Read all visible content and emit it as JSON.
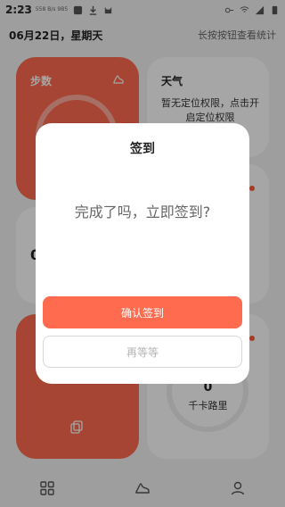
{
  "status_bar": {
    "time": "2:23",
    "speed_text": "558 B/s 9B5",
    "icons_left": [
      "image-icon",
      "download-icon",
      "cat-icon"
    ],
    "icons_right": [
      "key-icon",
      "wifi-icon",
      "signal-icon",
      "battery-icon"
    ]
  },
  "header": {
    "date": "06月22日，星期天",
    "hint": "长按按钮查看统计"
  },
  "cards": {
    "steps": {
      "title": "步数",
      "icon": "shoe-icon"
    },
    "weather": {
      "title": "天气",
      "text": "暂无定位权限，点击开启定位权限"
    },
    "left2": {
      "value": "0"
    },
    "left3": {
      "stub": "****"
    },
    "calories": {
      "value": "0",
      "label": "千卡路里"
    }
  },
  "bottom_nav": [
    {
      "icon": "grid-icon"
    },
    {
      "icon": "shoe-icon"
    },
    {
      "icon": "user-icon"
    }
  ],
  "dialog": {
    "title": "签到",
    "message": "完成了吗，立即签到?",
    "confirm_label": "确认签到",
    "wait_label": "再等等"
  },
  "colors": {
    "accent": "#ff6b4f",
    "overlay": "#00000059"
  }
}
